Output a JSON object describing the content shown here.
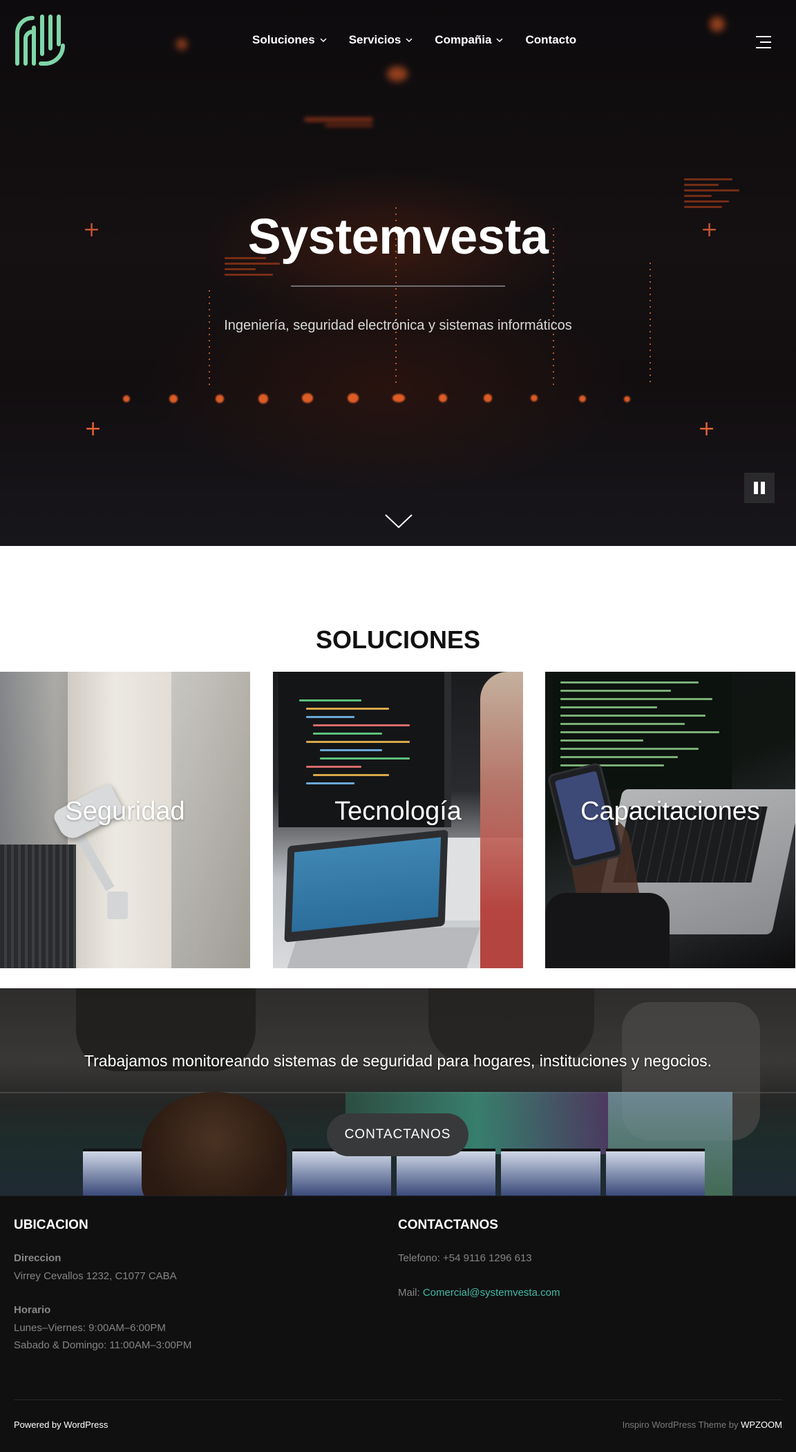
{
  "nav": {
    "logo": "systemvesta-logo-icon",
    "items": [
      {
        "label": "Soluciones",
        "has_dropdown": true
      },
      {
        "label": "Servicios",
        "has_dropdown": true
      },
      {
        "label": "Compañia",
        "has_dropdown": true
      },
      {
        "label": "Contacto",
        "has_dropdown": false
      }
    ],
    "menu_icon": "hamburger-menu-icon"
  },
  "hero": {
    "title": "Systemvesta",
    "subtitle": "Ingeniería, seguridad electrónica y sistemas informáticos",
    "pause_icon": "pause-icon",
    "scroll_icon": "chevron-down-icon"
  },
  "solutions": {
    "title": "SOLUCIONES",
    "cards": [
      {
        "label": "Seguridad"
      },
      {
        "label": "Tecnología"
      },
      {
        "label": "Capacitaciones"
      }
    ]
  },
  "cta": {
    "text": "Trabajamos monitoreando sistemas de seguridad para hogares, instituciones y negocios.",
    "button": "CONTACTANOS"
  },
  "footer": {
    "location": {
      "heading": "UBICACION",
      "address_label": "Direccion",
      "address": "Virrey Cevallos 1232, C1077 CABA",
      "hours_label": "Horario",
      "hours_weekdays": "Lunes–Viernes: 9:00AM–6:00PM",
      "hours_weekend": "Sabado & Domingo: 11:00AM–3:00PM"
    },
    "contact": {
      "heading": "CONTACTANOS",
      "phone": "Telefono: +54 9116 1296 613",
      "mail_label": "Mail: ",
      "mail": "Comercial@systemvesta.com"
    },
    "powered": "Powered by WordPress",
    "theme_prefix": "Inspiro WordPress Theme by ",
    "theme_vendor": "WPZOOM"
  },
  "colors": {
    "accent_green": "#7fd6a8",
    "link_teal": "#3fb9a0",
    "footer_bg": "#101011",
    "hero_glow": "#ff6a2a"
  }
}
